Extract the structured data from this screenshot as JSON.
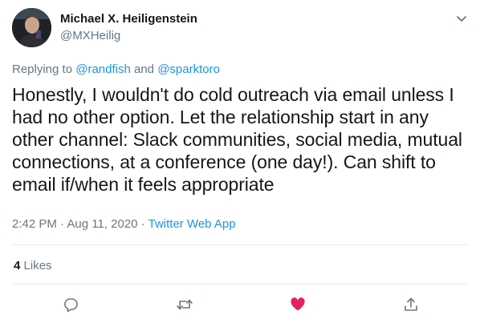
{
  "author": {
    "name": "Michael X. Heiligenstein",
    "handle": "@MXHeilig"
  },
  "reply": {
    "prefix": "Replying to",
    "mention1": "@randfish",
    "conj": "and",
    "mention2": "@sparktoro"
  },
  "tweet": {
    "lines": [
      "Honestly, I wouldn't do cold outreach via email unless I",
      "had no other option. Let the relationship start in any",
      "other channel: Slack communities, social media, mutual",
      "connections, at a conference (one day!). Can shift to",
      "email if/when it feels appropriate"
    ]
  },
  "meta": {
    "time": "2:42 PM",
    "sep1": "·",
    "date": "Aug 11, 2020",
    "sep2": "·",
    "source": "Twitter Web App"
  },
  "stats": {
    "likes_count": "4",
    "likes_label": "Likes"
  },
  "icons": {
    "more": "chevron-down-icon",
    "reply": "reply-icon",
    "retweet": "retweet-icon",
    "like": "heart-icon",
    "share": "share-icon"
  },
  "colors": {
    "link": "#1b95e0",
    "muted": "#657786",
    "liked": "#e0245e"
  }
}
